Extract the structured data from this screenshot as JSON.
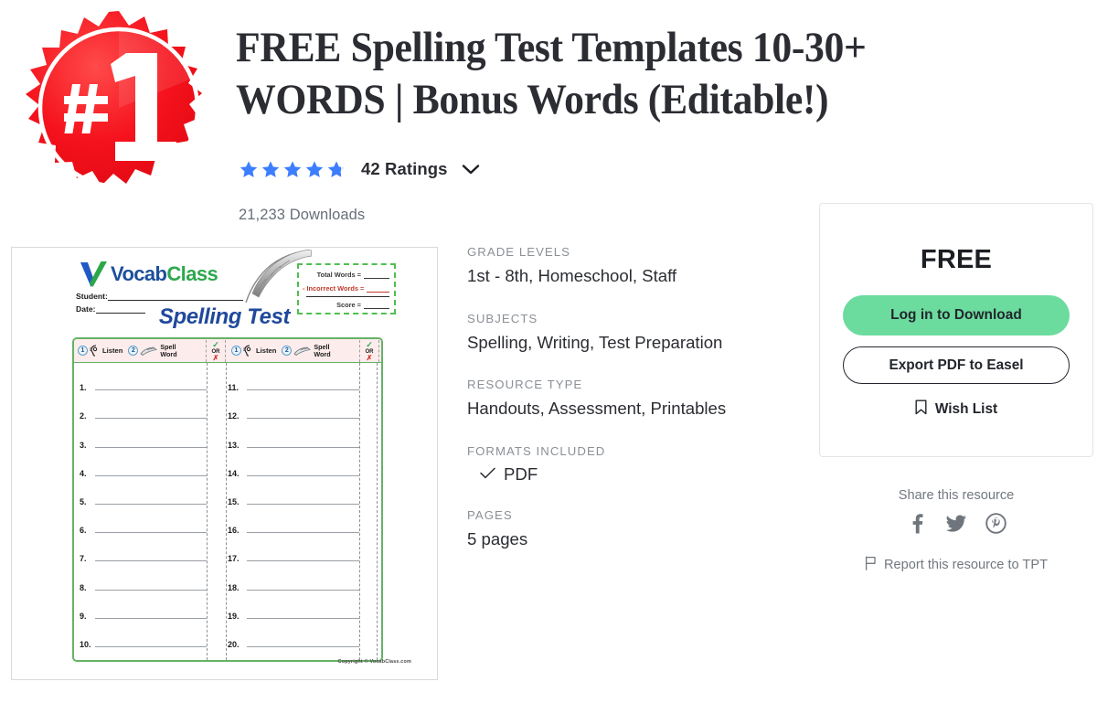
{
  "badge": {
    "label": "#1",
    "color": "#f5121c",
    "ring_color": "#ffffff"
  },
  "header": {
    "title_line1": "FREE Spelling Test Templates 10-30+",
    "title_line2": "WORDS | Bonus Words (Editable!)",
    "rating": {
      "stars_filled": 4.8,
      "stars_total": 5,
      "count_label": "42 Ratings",
      "star_color": "#3d7eff",
      "chevron_icon": "chevron-down-icon"
    },
    "downloads": "21,233 Downloads"
  },
  "preview": {
    "brand_v": "Vocab",
    "brand_c": "Class",
    "student_label": "Student:",
    "date_label": "Date:",
    "score_box": {
      "total_words": "Total Words =",
      "incorrect_words": "Incorrect Words =",
      "score": "Score ="
    },
    "sheet_title": "Spelling Test",
    "header_steps": {
      "step1_num": "1",
      "step1_label": "Listen",
      "step2_num": "2",
      "step2_label_line1": "Spell",
      "step2_label_line2": "Word",
      "mark_check": "✓",
      "mark_or": "OR",
      "mark_x": "✗"
    },
    "rows_left": [
      "1.",
      "2.",
      "3.",
      "4.",
      "5.",
      "6.",
      "7.",
      "8.",
      "9.",
      "10."
    ],
    "rows_right": [
      "11.",
      "12.",
      "13.",
      "14.",
      "15.",
      "16.",
      "17.",
      "18.",
      "19.",
      "20."
    ],
    "copyright": "Copyright © VocabClass.com"
  },
  "meta": {
    "groups": [
      {
        "label": "GRADE LEVELS",
        "value": "1st - 8th, Homeschool, Staff"
      },
      {
        "label": "SUBJECTS",
        "value": "Spelling, Writing, Test Preparation"
      },
      {
        "label": "RESOURCE TYPE",
        "value": "Handouts, Assessment, Printables"
      }
    ],
    "formats": {
      "label": "FORMATS INCLUDED",
      "items": [
        "PDF"
      ],
      "check_icon": "check-icon"
    },
    "pages": {
      "label": "PAGES",
      "value": "5 pages"
    }
  },
  "buycard": {
    "price": "FREE",
    "primary_button": "Log in to Download",
    "secondary_button": "Export PDF to Easel",
    "wishlist_label": "Wish List",
    "wishlist_icon": "bookmark-icon",
    "primary_color": "#6cdb9e"
  },
  "share": {
    "title": "Share this resource",
    "icons": [
      "facebook-icon",
      "twitter-icon",
      "pinterest-icon"
    ],
    "report_label": "Report this resource to TPT",
    "report_icon": "flag-icon"
  }
}
